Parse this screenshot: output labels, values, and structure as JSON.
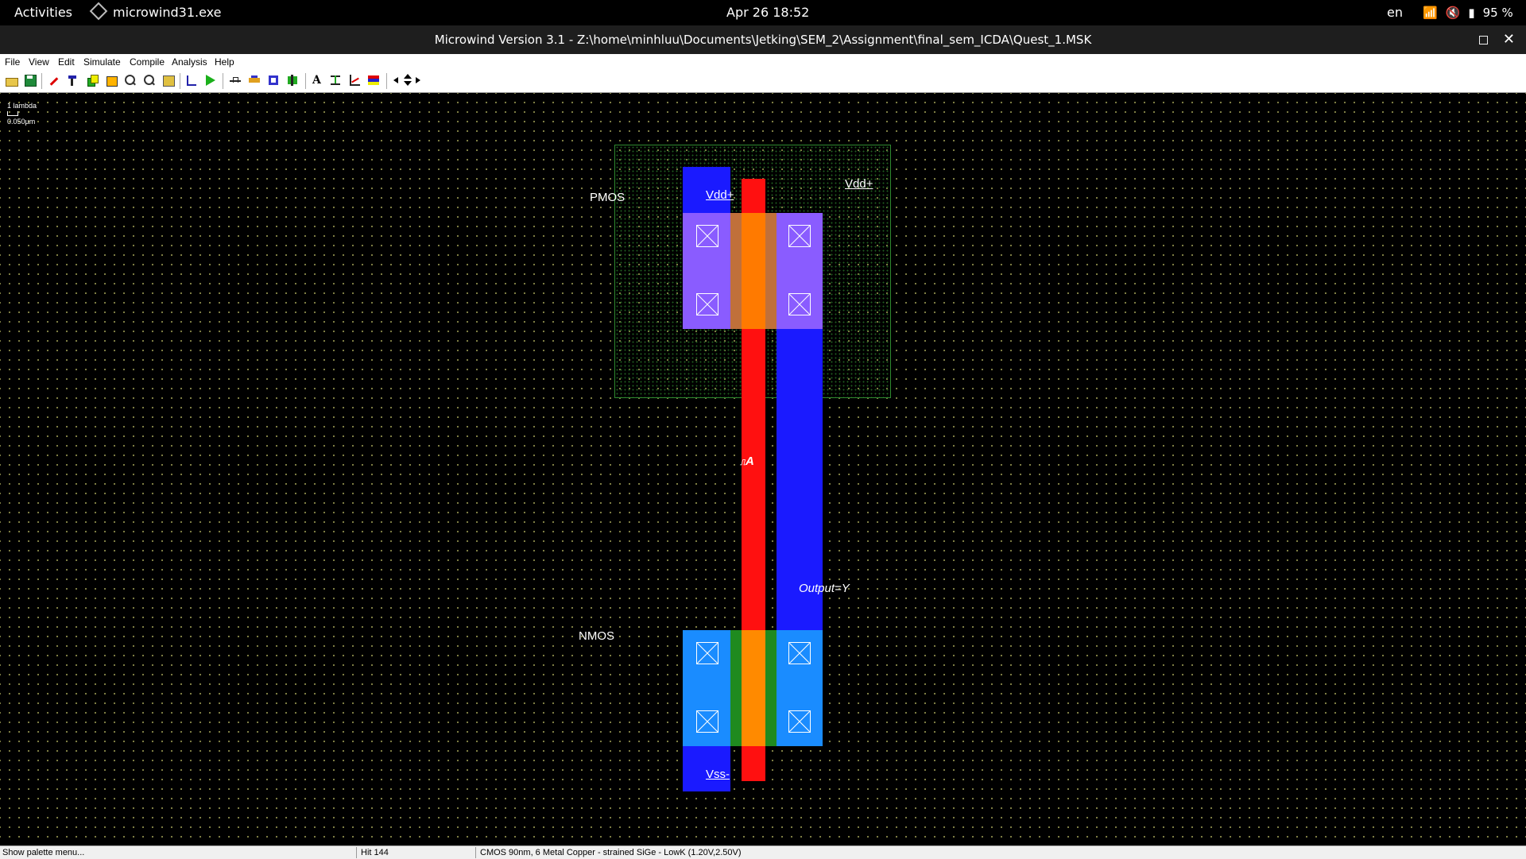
{
  "topbar": {
    "activities": "Activities",
    "app_name": "microwind31.exe",
    "clock": "Apr 26  18:52",
    "lang": "en",
    "battery": "95 %"
  },
  "window": {
    "title": "Microwind Version 3.1 - Z:\\home\\minhluu\\Documents\\Jetking\\SEM_2\\Assignment\\final_sem_ICDA\\Quest_1.MSK",
    "close": "✕"
  },
  "menubar": {
    "items": [
      "File",
      "View",
      "Edit",
      "Simulate",
      "Compile",
      "Analysis",
      "Help"
    ]
  },
  "toolbar": {
    "icons": [
      "open-file-icon",
      "save-icon",
      "draw-box-icon",
      "edit-icon",
      "copy-icon",
      "stretch-icon",
      "zoom-in-icon",
      "zoom-out-icon",
      "view-all-icon",
      "measure-icon",
      "run-simulation-icon",
      "pulse-icon",
      "connect-icon",
      "cut-icon",
      "nmos-icon",
      "text-icon",
      "cross-section-icon",
      "graph-icon",
      "palette-icon",
      "pan-left-icon",
      "pan-updown-icon",
      "pan-right-icon"
    ]
  },
  "canvas": {
    "scale_label": "1 lambda",
    "scale_value": "0.050µm",
    "labels": {
      "pmos": "PMOS",
      "nmos": "NMOS",
      "vdd_left": "Vdd+",
      "vdd_right": "Vdd+",
      "input": "A",
      "output": "Output=Y",
      "vss": "Vss-"
    }
  },
  "layer_colors": {
    "polysilicon": "#ff1010",
    "metal1": "#1a1aff",
    "p_diffusion": "#8a5cff",
    "n_diffusion": "#1a8cff",
    "gate_pmos": "#ff7a00",
    "gate_nmos": "#ff8a00",
    "n_well_border": "#2f8a2f"
  },
  "statusbar": {
    "message": "Show palette menu...",
    "hit": "Hit 144",
    "technology": "CMOS 90nm, 6 Metal Copper - strained SiGe - LowK (1.20V,2.50V)"
  }
}
